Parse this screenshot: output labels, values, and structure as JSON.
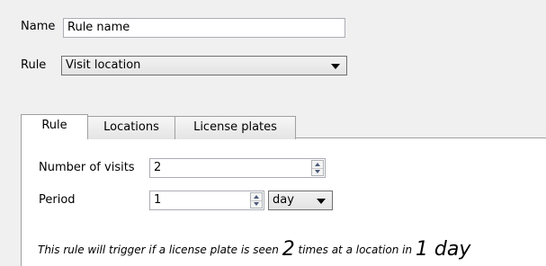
{
  "form": {
    "name_label": "Name",
    "name_value": "Rule name",
    "rule_label": "Rule",
    "rule_value": "Visit location"
  },
  "tabs": [
    {
      "label": "Rule",
      "active": true
    },
    {
      "label": "Locations",
      "active": false
    },
    {
      "label": "License plates",
      "active": false
    }
  ],
  "rule_tab": {
    "visits_label": "Number of visits",
    "visits_value": "2",
    "period_label": "Period",
    "period_value": "1",
    "period_unit": "day",
    "summary_prefix": "This rule will trigger if a license plate is seen",
    "summary_count": "2",
    "summary_mid": "times at a location in",
    "summary_period": "1 day"
  },
  "icons": {
    "dropdown": "chevron-down-icon",
    "spinner": "spinner-arrows-icon"
  }
}
